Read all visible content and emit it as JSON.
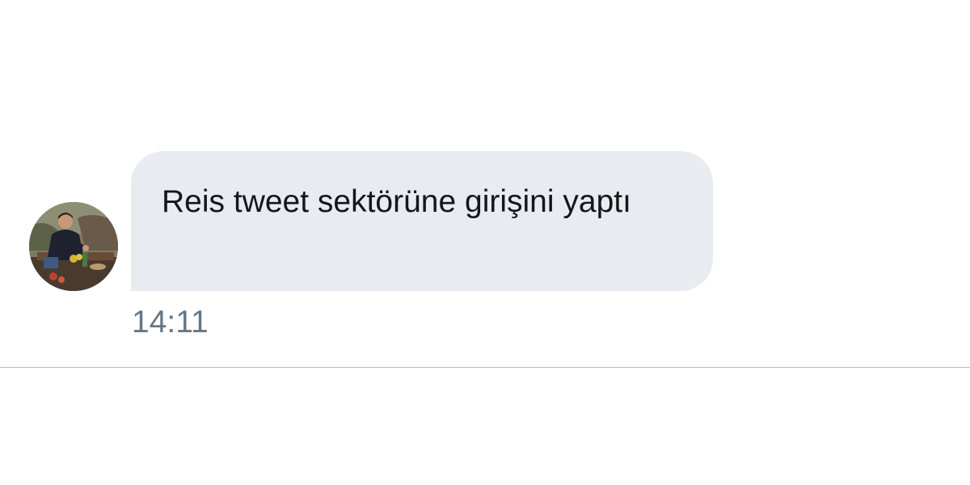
{
  "conversation": {
    "message": {
      "text": "Reis tweet sektörüne girişini yaptı",
      "time": "14:11"
    },
    "sender": {
      "avatar_icon": "user-avatar-photo"
    }
  },
  "colors": {
    "bubble_bg": "#e8ebef",
    "message_text": "#14171a",
    "timestamp_text": "#657786",
    "divider": "#b9bcc0"
  }
}
